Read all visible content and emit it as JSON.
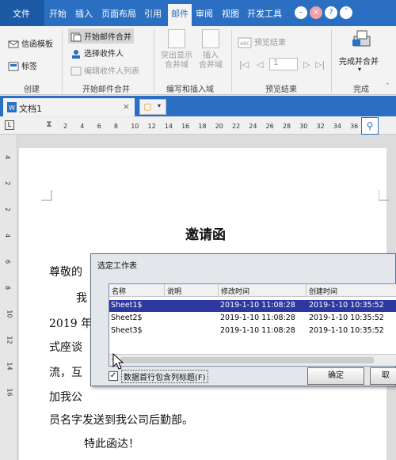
{
  "ribbon_tabs": [
    "文件",
    "开始",
    "插入",
    "页面布局",
    "引用",
    "邮件",
    "审阅",
    "视图",
    "开发工具"
  ],
  "active_tab": "邮件",
  "window_controls": [
    "minimize",
    "close",
    "help",
    "ribbon-toggle"
  ],
  "ribbon": {
    "create": {
      "envelope_template": "信函模板",
      "labels": "标签",
      "group_label": "创建"
    },
    "start_mail_merge": {
      "start_merge": "开始邮件合并",
      "select_recipients": "选择收件人",
      "edit_recipients": "编辑收件人列表",
      "group_label": "开始邮件合并"
    },
    "write_insert": {
      "highlight_fields": "突出显示\n合并域",
      "insert_field": "插入\n合并域",
      "group_label": "编写和插入域"
    },
    "preview": {
      "preview_results": "预览结果",
      "record_number": "1",
      "group_label": "预览结果"
    },
    "finish": {
      "finish_merge": "完成并合并",
      "group_label": "完成"
    }
  },
  "document_tab": {
    "name": "文档1"
  },
  "ruler": {
    "h_ticks": [
      "2",
      "4",
      "6",
      "8",
      "10",
      "12",
      "14",
      "16",
      "18",
      "20",
      "22",
      "24",
      "26",
      "28",
      "30",
      "32",
      "34",
      "36"
    ],
    "v_ticks": [
      "4",
      "2",
      "2",
      "4",
      "6",
      "8",
      "10",
      "12",
      "14",
      "16"
    ]
  },
  "document": {
    "title": "邀请函",
    "lines": [
      "尊敬的",
      "我",
      "2019 年",
      "式座谈",
      "流，互",
      "加我公",
      "员名字发送到我公司后勤部。",
      "特此函达！"
    ],
    "colors": {
      "accent": "#2b6fc2",
      "selection": "#2d39a0"
    }
  },
  "dialog": {
    "title": "选定工作表",
    "columns": [
      "名称",
      "说明",
      "修改时间",
      "创建时间"
    ],
    "rows": [
      {
        "name": "Sheet1$",
        "desc": "",
        "modified": "2019-1-10 11:08:28",
        "created": "2019-1-10 10:35:52",
        "selected": true
      },
      {
        "name": "Sheet2$",
        "desc": "",
        "modified": "2019-1-10 11:08:28",
        "created": "2019-1-10 10:35:52",
        "selected": false
      },
      {
        "name": "Sheet3$",
        "desc": "",
        "modified": "2019-1-10 11:08:28",
        "created": "2019-1-10 10:35:52",
        "selected": false
      }
    ],
    "first_row_header_label": "数据首行包含列标题(F)",
    "first_row_header_checked": true,
    "ok_label": "确定",
    "cancel_label": "取"
  }
}
